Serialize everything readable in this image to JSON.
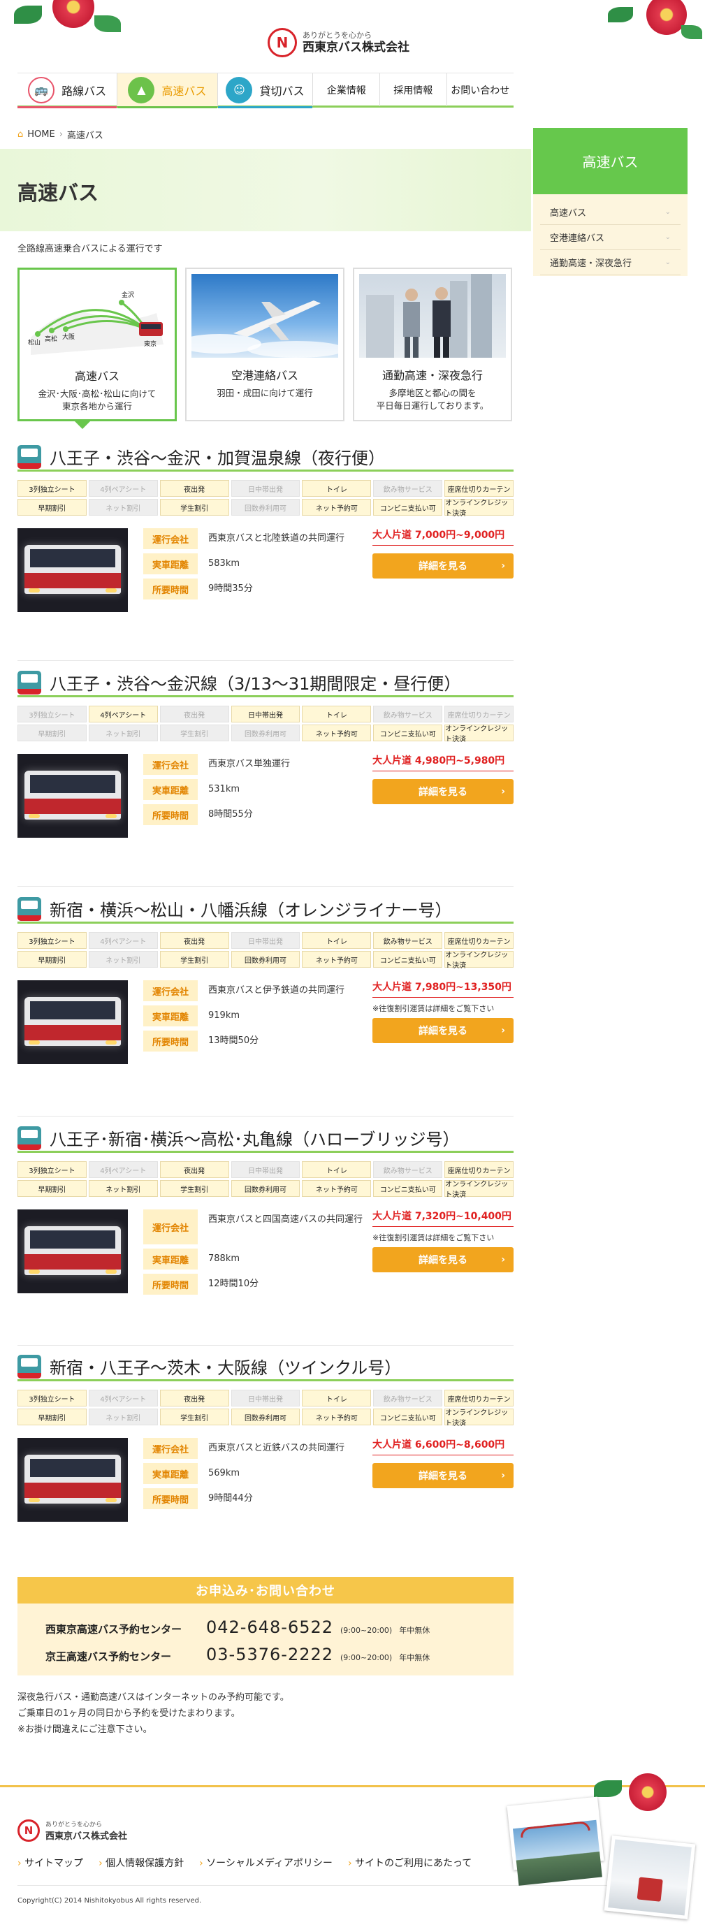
{
  "header": {
    "tagline": "ありがとうを心から",
    "company": "西東京バス株式会社"
  },
  "nav": [
    {
      "label": "路線バス",
      "icon": "route-bus-icon",
      "color": "#e8546a"
    },
    {
      "label": "高速バス",
      "icon": "highway-icon",
      "color": "#6cc24a"
    },
    {
      "label": "貸切バス",
      "icon": "chartered-bus-icon",
      "color": "#2da6c8"
    },
    {
      "label": "企業情報"
    },
    {
      "label": "採用情報"
    },
    {
      "label": "お問い合わせ"
    }
  ],
  "breadcrumb": {
    "home": "HOME",
    "current": "高速バス"
  },
  "page": {
    "title": "高速バス",
    "lead": "全路線高速乗合バスによる運行です"
  },
  "side": {
    "title": "高速バス",
    "items": [
      "高速バス",
      "空港連絡バス",
      "通勤高速・深夜急行"
    ]
  },
  "categories": [
    {
      "title": "高速バス",
      "desc1": "金沢･大阪･高松･松山に向けて",
      "desc2": "東京各地から運行",
      "map": {
        "kanazawa": "金沢",
        "matsuyama": "松山",
        "takamatsu": "高松",
        "osaka": "大阪",
        "tokyo": "東京"
      }
    },
    {
      "title": "空港連絡バス",
      "desc1": "羽田・成田に向けて運行",
      "desc2": ""
    },
    {
      "title": "通勤高速・深夜急行",
      "desc1": "多摩地区と都心の間を",
      "desc2": "平日毎日運行しております。"
    }
  ],
  "labels": {
    "operator": "運行会社",
    "distance": "実車距離",
    "duration": "所要時間",
    "detail": "詳細を見る",
    "discount_note": "※往復割引運賃は詳細をご覧下さい"
  },
  "feature_names": [
    "3列独立シート",
    "4列ペアシート",
    "夜出発",
    "日中帯出発",
    "トイレ",
    "飲み物サービス",
    "座席仕切りカーテン",
    "早期割引",
    "ネット割引",
    "学生割引",
    "回数券利用可",
    "ネット予約可",
    "コンビニ支払い可",
    "オンラインクレジット決済"
  ],
  "routes": [
    {
      "title": "八王子・渋谷～金沢・加賀温泉線（夜行便）",
      "features": [
        true,
        false,
        true,
        false,
        true,
        false,
        true,
        true,
        false,
        true,
        false,
        true,
        true,
        true
      ],
      "operator": "西東京バスと北陸鉄道の共同運行",
      "distance": "583km",
      "duration": "9時間35分",
      "price": "大人片道  7,000円~9,000円",
      "note": ""
    },
    {
      "title": "八王子・渋谷～金沢線（3/13～31期間限定・昼行便）",
      "features": [
        false,
        true,
        false,
        true,
        true,
        false,
        false,
        false,
        false,
        false,
        false,
        true,
        true,
        true
      ],
      "operator": "西東京バス単独運行",
      "distance": "531km",
      "duration": "8時間55分",
      "price": "大人片道  4,980円~5,980円",
      "note": ""
    },
    {
      "title": "新宿・横浜～松山・八幡浜線（オレンジライナー号）",
      "features": [
        true,
        false,
        true,
        false,
        true,
        true,
        true,
        true,
        false,
        true,
        true,
        true,
        true,
        true
      ],
      "operator": "西東京バスと伊予鉄道の共同運行",
      "distance": "919km",
      "duration": "13時間50分",
      "price": "大人片道  7,980円~13,350円",
      "note": "※往復割引運賃は詳細をご覧下さい"
    },
    {
      "title": "八王子･新宿･横浜～高松･丸亀線（ハローブリッジ号）",
      "features": [
        true,
        false,
        true,
        false,
        true,
        false,
        true,
        true,
        true,
        true,
        true,
        true,
        true,
        true
      ],
      "operator": "西東京バスと四国高速バスの共同運行",
      "distance": "788km",
      "duration": "12時間10分",
      "price": "大人片道  7,320円~10,400円",
      "note": "※往復割引運賃は詳細をご覧下さい"
    },
    {
      "title": "新宿・八王子～茨木・大阪線（ツインクル号）",
      "features": [
        true,
        false,
        true,
        false,
        true,
        false,
        true,
        true,
        false,
        true,
        true,
        true,
        true,
        true
      ],
      "operator": "西東京バスと近鉄バスの共同運行",
      "distance": "569km",
      "duration": "9時間44分",
      "price": "大人片道  6,600円~8,600円",
      "note": ""
    }
  ],
  "contact": {
    "title": "お申込み･お問い合わせ",
    "centers": [
      {
        "name": "西東京高速バス予約センター",
        "tel": "042-648-6522",
        "hours": "(9:00~20:00)",
        "closed": "年中無休"
      },
      {
        "name": "京王高速バス予約センター",
        "tel": "03-5376-2222",
        "hours": "(9:00~20:00)",
        "closed": "年中無休"
      }
    ]
  },
  "bottom_note": [
    "深夜急行バス・通勤高速バスはインターネットのみ予約可能です。",
    "ご乗車日の1ヶ月の同日から予約を受けたまわります。",
    "※お掛け間違えにご注意下さい。"
  ],
  "footer": {
    "tagline": "ありがとうを心から",
    "company": "西東京バス株式会社",
    "links": [
      "サイトマップ",
      "個人情報保護方針",
      "ソーシャルメディアポリシー",
      "サイトのご利用にあたって"
    ],
    "copyright": "Copyright(C) 2014 Nishitokyobus All rights reserved."
  },
  "colors": {
    "accent_green": "#6cc24a",
    "orange": "#f2a51e",
    "red": "#e02020"
  }
}
